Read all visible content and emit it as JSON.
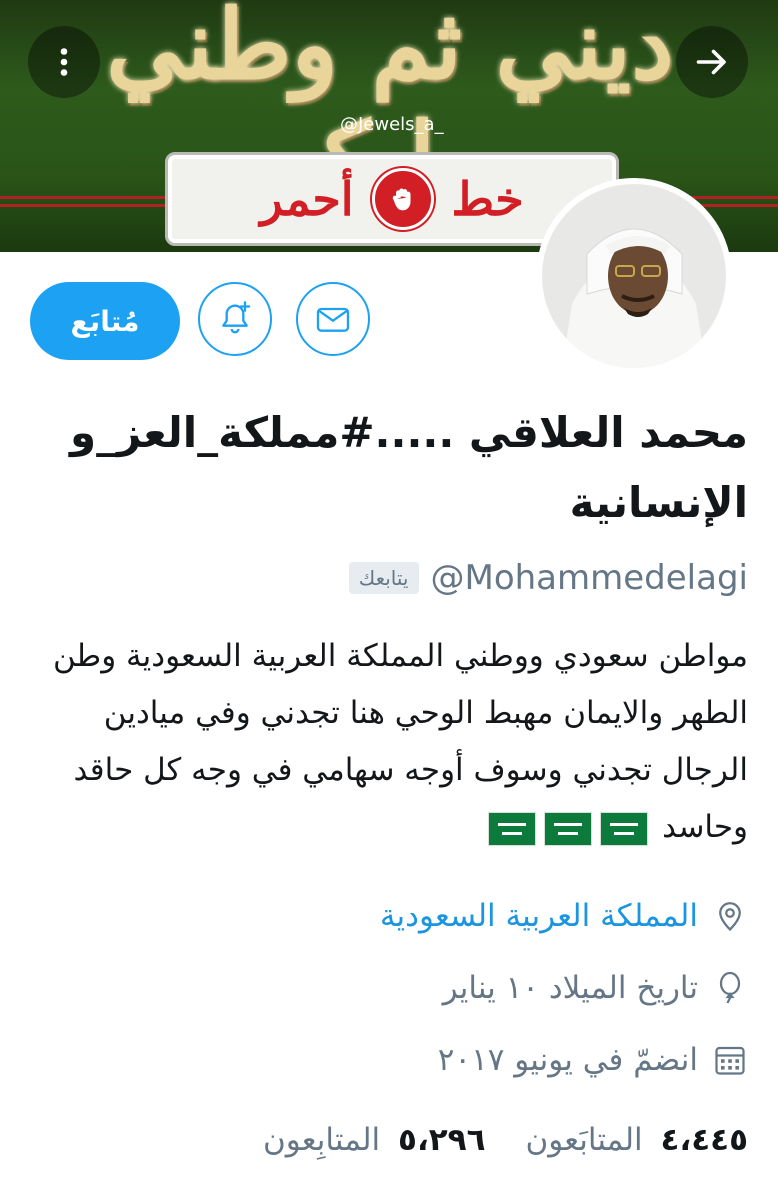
{
  "banner": {
    "calligraphy": "ديني ثم وطني ومليكي",
    "watermark_handle": "@Jewels_a_",
    "sign_left": "خط",
    "sign_right": "أحمر"
  },
  "profile": {
    "display_name": "محمد العلاقي .....#مملكة_العز_و الإنسانية",
    "handle": "@Mohammedelagi",
    "follows_you_label": "يتابعك",
    "bio": "مواطن سعودي ووطني المملكة العربية السعودية وطن الطهر والايمان مهبط الوحي هنا تجدني وفي ميادين  الرجال تجدني وسوف أوجه سهامي في وجه كل حاقد وحاسد",
    "location": "المملكة العربية السعودية",
    "birthday": "تاريخ الميلاد ١٠ يناير",
    "joined": "انضمّ في يونيو ٢٠١٧"
  },
  "actions": {
    "follow_label": "مُتابَع"
  },
  "stats": {
    "following_count": "٤،٤٤٥",
    "following_label": "المتابَعون",
    "followers_count": "٥،٢٩٦",
    "followers_label": "المتابِعون"
  },
  "icons": {
    "back": "arrow-right-icon",
    "more": "more-vertical-icon",
    "notify": "bell-plus-icon",
    "message": "envelope-icon",
    "location": "location-pin-icon",
    "birthday": "balloon-icon",
    "joined": "calendar-icon"
  },
  "colors": {
    "accent": "#1da1f2",
    "link": "#1b95e0",
    "muted": "#657786"
  }
}
